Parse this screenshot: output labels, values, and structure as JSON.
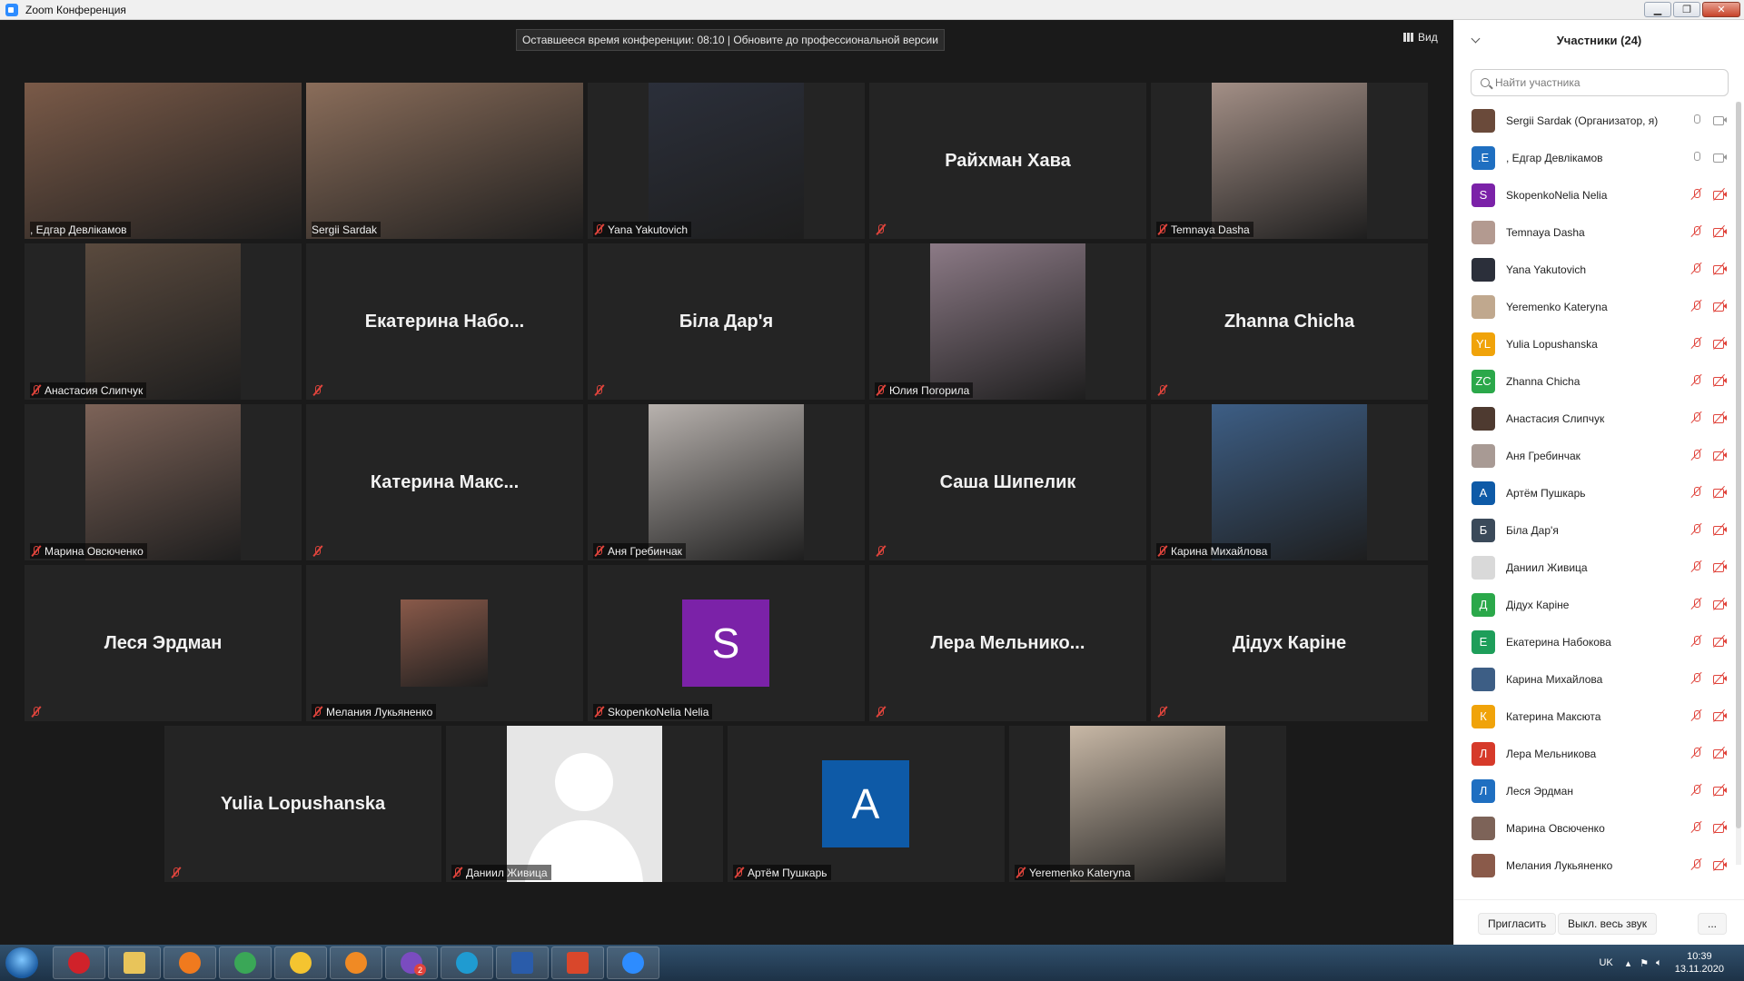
{
  "window": {
    "title": "Zoom Конференция",
    "buttons": {
      "minimize": "▁",
      "maximize": "❐",
      "close": "✕"
    }
  },
  "meeting": {
    "banner": "Оставшееся время конференции: 08:10 | Обновите до профессиональной версии",
    "view_label": "Вид",
    "tiles": [
      {
        "name": "Едгар Девлікамов",
        "label": ", Едгар Девлікамов",
        "kind": "video",
        "active": true,
        "muted": false,
        "bg": "#7a5a48"
      },
      {
        "name": "Sergii Sardak",
        "label": "Sergii Sardak",
        "kind": "video",
        "muted": false,
        "bg": "#8a6d5a"
      },
      {
        "name": "Yana Yakutovich",
        "label": "Yana Yakutovich",
        "kind": "photo",
        "muted": true,
        "bg": "#2b2f3a"
      },
      {
        "name": "Райхман Хава",
        "label": "",
        "kind": "name",
        "muted": true
      },
      {
        "name": "Temnaya Dasha",
        "label": "Temnaya Dasha",
        "kind": "photo",
        "muted": true,
        "bg": "#a38f86"
      },
      {
        "name": "Анастасия Слипчук",
        "label": "Анастасия Слипчук",
        "kind": "photo",
        "muted": true,
        "bg": "#5a4a3e"
      },
      {
        "name": "Екатерина  Набо...",
        "label": "",
        "kind": "name",
        "muted": true
      },
      {
        "name": "Біла Дар'я",
        "label": "",
        "kind": "name",
        "muted": true
      },
      {
        "name": "Юлия Погорила",
        "label": "Юлия Погорила",
        "kind": "photo",
        "muted": true,
        "bg": "#8c7a86"
      },
      {
        "name": "Zhanna Chicha",
        "label": "",
        "kind": "name",
        "muted": true
      },
      {
        "name": "Марина Овсюченко",
        "label": "Марина Овсюченко",
        "kind": "photo",
        "muted": true,
        "bg": "#7d6358"
      },
      {
        "name": "Катерина  Макс...",
        "label": "",
        "kind": "name",
        "muted": true
      },
      {
        "name": "Аня Гребинчак",
        "label": "Аня Гребинчак",
        "kind": "photo",
        "muted": true,
        "bg": "#b8b2ae"
      },
      {
        "name": "Саша Шипелик",
        "label": "",
        "kind": "name",
        "muted": true
      },
      {
        "name": "Карина Михайлова",
        "label": "Карина Михайлова",
        "kind": "photo",
        "muted": true,
        "bg": "#3d5e85"
      },
      {
        "name": "Леся Эрдман",
        "label": "",
        "kind": "name",
        "muted": true
      },
      {
        "name": "Мелания Лукьяненко",
        "label": "Мелания Лукьяненко",
        "kind": "small-photo",
        "muted": true,
        "bg": "#8a5a4a"
      },
      {
        "name": "SkopenkoNelia Nelia",
        "label": "SkopenkoNelia Nelia",
        "kind": "initial",
        "initial": "S",
        "initial_color": "#7b22a8",
        "muted": true
      },
      {
        "name": "Лера  Мельнико...",
        "label": "",
        "kind": "name",
        "muted": true
      },
      {
        "name": "Дідух Каріне",
        "label": "",
        "kind": "name",
        "muted": true
      },
      {
        "name": "Yulia Lopushanska",
        "label": "",
        "kind": "name",
        "muted": true
      },
      {
        "name": "Даниил Живица",
        "label": "Даниил Живица",
        "kind": "silhouette",
        "muted": true,
        "bg": "#e6e6e6"
      },
      {
        "name": "Артём Пушкарь",
        "label": "Артём Пушкарь",
        "kind": "initial",
        "initial": "A",
        "initial_color": "#0e5aa7",
        "muted": true
      },
      {
        "name": "Yeremenko Kateryna",
        "label": "Yeremenko Kateryna",
        "kind": "photo",
        "muted": true,
        "bg": "#c8b8a6"
      }
    ]
  },
  "panel": {
    "title": "Участники (24)",
    "search_placeholder": "Найти участника",
    "participants": [
      {
        "name": "Sergii Sardak (Организатор, я)",
        "avatar": "",
        "color": "#6a4a3a",
        "mic": "on",
        "cam": "on"
      },
      {
        "name": ", Едгар Девлікамов",
        "avatar": ".E",
        "color": "#1f6fc1",
        "mic": "on",
        "cam": "on"
      },
      {
        "name": "SkopenkoNelia Nelia",
        "avatar": "S",
        "color": "#7b22a8",
        "mic": "off",
        "cam": "off"
      },
      {
        "name": "Temnaya Dasha",
        "avatar": "",
        "color": "#b39a90",
        "mic": "off",
        "cam": "off"
      },
      {
        "name": "Yana Yakutovich",
        "avatar": "",
        "color": "#2b2f3a",
        "mic": "off",
        "cam": "off"
      },
      {
        "name": "Yeremenko Kateryna",
        "avatar": "",
        "color": "#c0a88e",
        "mic": "off",
        "cam": "off"
      },
      {
        "name": "Yulia Lopushanska",
        "avatar": "YL",
        "color": "#f0a30a",
        "mic": "off",
        "cam": "off"
      },
      {
        "name": "Zhanna Chicha",
        "avatar": "ZC",
        "color": "#2ba84a",
        "mic": "off",
        "cam": "off"
      },
      {
        "name": "Анастасия Слипчук",
        "avatar": "",
        "color": "#4e3a30",
        "mic": "off",
        "cam": "off"
      },
      {
        "name": "Аня Гребинчак",
        "avatar": "",
        "color": "#a89a94",
        "mic": "off",
        "cam": "off"
      },
      {
        "name": "Артём Пушкарь",
        "avatar": "A",
        "color": "#0e5aa7",
        "mic": "off",
        "cam": "off"
      },
      {
        "name": "Біла Дар'я",
        "avatar": "Б",
        "color": "#3b4a5a",
        "mic": "off",
        "cam": "off"
      },
      {
        "name": "Даниил Живица",
        "avatar": "",
        "color": "#d9d9d9",
        "mic": "off",
        "cam": "off"
      },
      {
        "name": "Дідух Каріне",
        "avatar": "Д",
        "color": "#2ba84a",
        "mic": "off",
        "cam": "off"
      },
      {
        "name": "Екатерина Набокова",
        "avatar": "Е",
        "color": "#1e9e5a",
        "mic": "off",
        "cam": "off"
      },
      {
        "name": "Карина Михайлова",
        "avatar": "",
        "color": "#3d5e85",
        "mic": "off",
        "cam": "off"
      },
      {
        "name": "Катерина Максюта",
        "avatar": "К",
        "color": "#f0a30a",
        "mic": "off",
        "cam": "off"
      },
      {
        "name": "Лера Мельникова",
        "avatar": "Л",
        "color": "#d63a2a",
        "mic": "off",
        "cam": "off"
      },
      {
        "name": "Леся Эрдман",
        "avatar": "Л",
        "color": "#1f6fc1",
        "mic": "off",
        "cam": "off"
      },
      {
        "name": "Марина Овсюченко",
        "avatar": "",
        "color": "#7d6358",
        "mic": "off",
        "cam": "off"
      },
      {
        "name": "Мелания Лукьяненко",
        "avatar": "",
        "color": "#8a5a4a",
        "mic": "off",
        "cam": "off"
      }
    ],
    "footer": {
      "invite": "Пригласить",
      "mute_all": "Выкл. весь звук",
      "more": "..."
    }
  },
  "taskbar": {
    "apps": [
      {
        "name": "opera",
        "color": "#d0222a"
      },
      {
        "name": "explorer",
        "color": "#e8c45a"
      },
      {
        "name": "firefox",
        "color": "#f07a1e"
      },
      {
        "name": "chrome",
        "color": "#3aa757"
      },
      {
        "name": "browser",
        "color": "#f4c430"
      },
      {
        "name": "media-player",
        "color": "#f08a24"
      },
      {
        "name": "viber",
        "color": "#7a4cc0",
        "badge": "2"
      },
      {
        "name": "edge",
        "color": "#1f9bd1"
      },
      {
        "name": "word",
        "color": "#2a5caa"
      },
      {
        "name": "presentation",
        "color": "#d9472b"
      },
      {
        "name": "zoom",
        "color": "#2d8cff"
      }
    ],
    "lang": "UK",
    "time": "10:39",
    "date": "13.11.2020"
  }
}
